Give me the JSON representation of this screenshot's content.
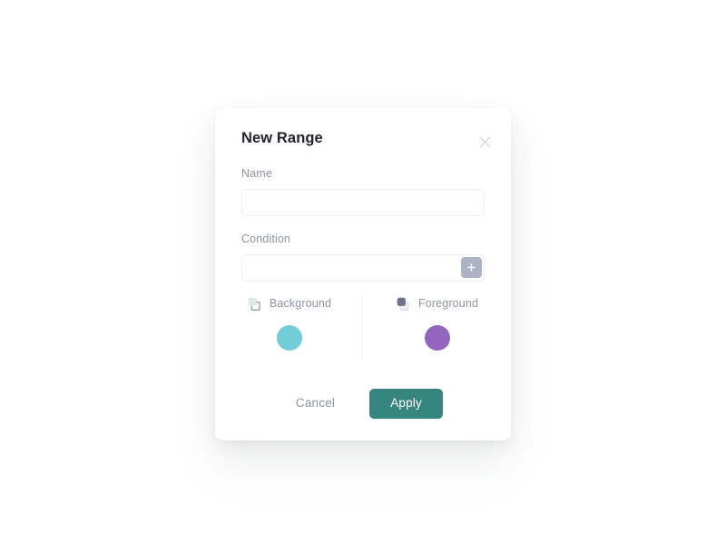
{
  "dialog": {
    "title": "New Range",
    "close_icon": "close-icon",
    "accent_color": "#35867f",
    "surface_color": "#ffffff",
    "page_background": "#ffffff"
  },
  "fields": [
    {
      "label": "Name",
      "value": "",
      "placeholder": "",
      "has_add_button": false
    },
    {
      "label": "Condition",
      "value": "",
      "placeholder": "",
      "has_add_button": true,
      "add_button_icon": "plus-icon",
      "add_button_color": "#aeb3c4"
    }
  ],
  "colors": {
    "background": {
      "label": "Background",
      "icon": "layers-back-icon",
      "swatch": "#72cdd9"
    },
    "foreground": {
      "label": "Foreground",
      "icon": "layers-front-icon",
      "swatch": "#9265c0"
    }
  },
  "footer": {
    "cancel_label": "Cancel",
    "apply_label": "Apply"
  }
}
